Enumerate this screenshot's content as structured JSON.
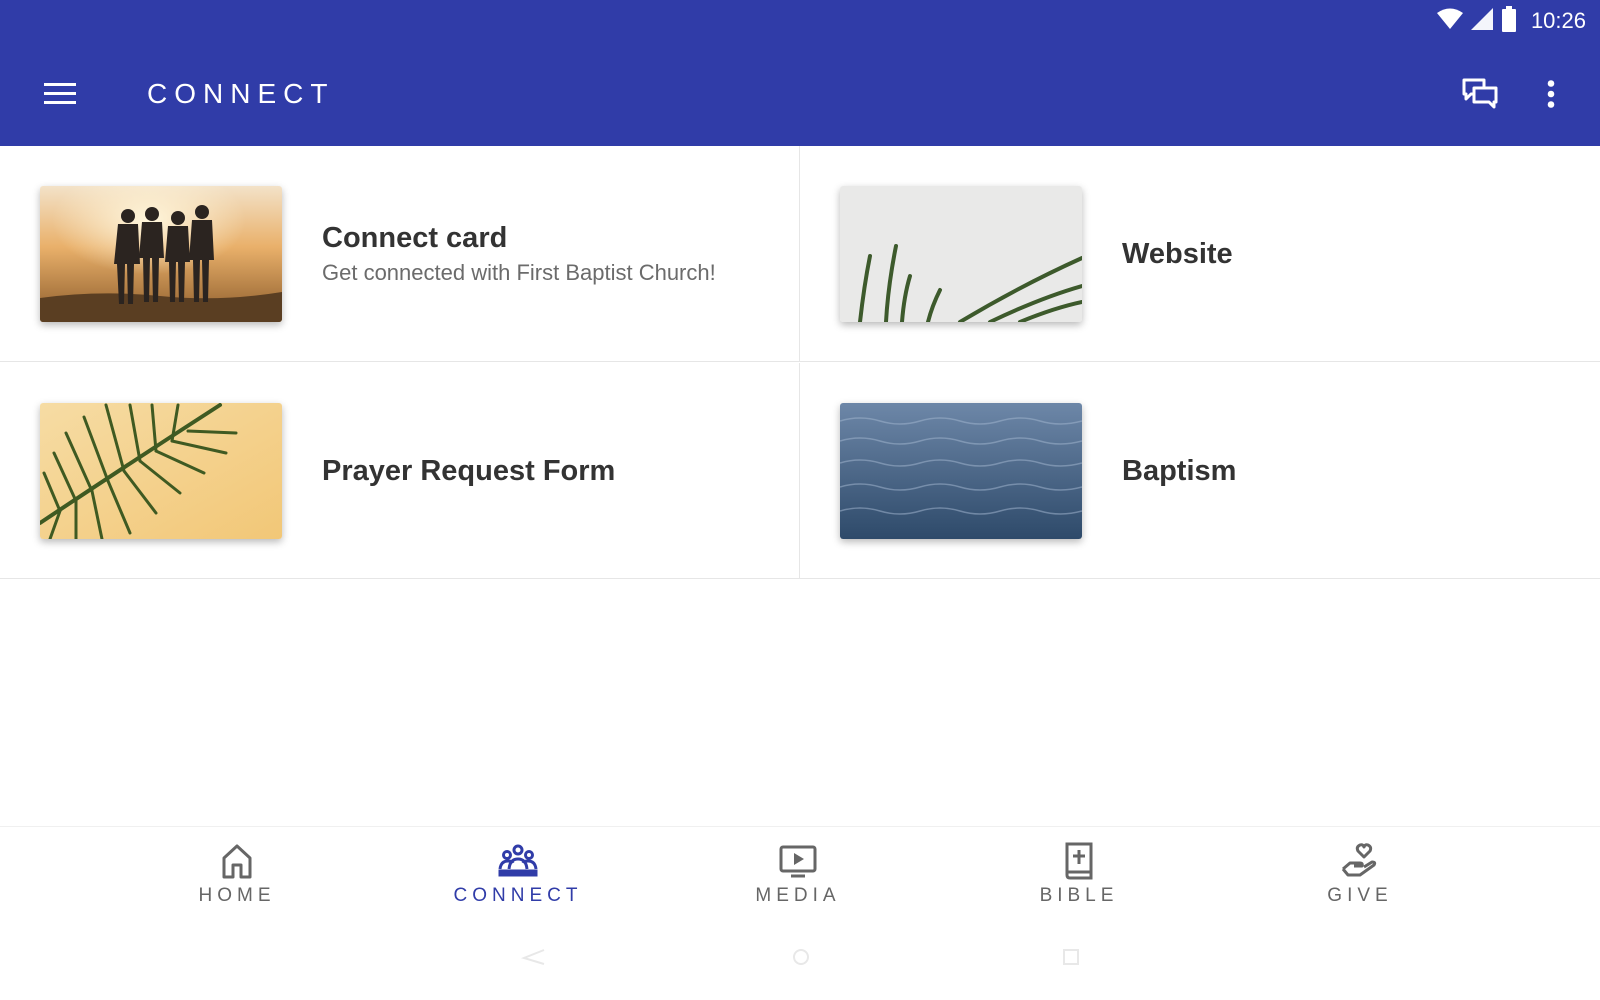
{
  "status_bar": {
    "time": "10:26",
    "icons": [
      "wifi-icon",
      "cellular-signal-icon",
      "battery-icon"
    ]
  },
  "app_bar": {
    "title": "CONNECT",
    "menu_icon": "hamburger-menu-icon",
    "actions": [
      "chat-icon",
      "more-vert-icon"
    ],
    "background_color": "#303ca8"
  },
  "cards": [
    {
      "title": "Connect card",
      "subtitle": "Get connected with First Baptist Church!",
      "image": "friends-sunset-photo"
    },
    {
      "title": "Website",
      "subtitle": "",
      "image": "palm-leaves-on-white-photo"
    },
    {
      "title": "Prayer Request Form",
      "subtitle": "",
      "image": "palm-leaf-on-yellow-photo"
    },
    {
      "title": "Baptism",
      "subtitle": "",
      "image": "ocean-water-photo"
    }
  ],
  "bottom_nav": {
    "items": [
      {
        "label": "HOME",
        "icon": "home-icon",
        "active": false
      },
      {
        "label": "CONNECT",
        "icon": "people-group-icon",
        "active": true
      },
      {
        "label": "MEDIA",
        "icon": "media-play-icon",
        "active": false
      },
      {
        "label": "BIBLE",
        "icon": "bible-icon",
        "active": false
      },
      {
        "label": "GIVE",
        "icon": "give-heart-hand-icon",
        "active": false
      }
    ],
    "active_color": "#303ca8",
    "inactive_color": "#666666"
  }
}
